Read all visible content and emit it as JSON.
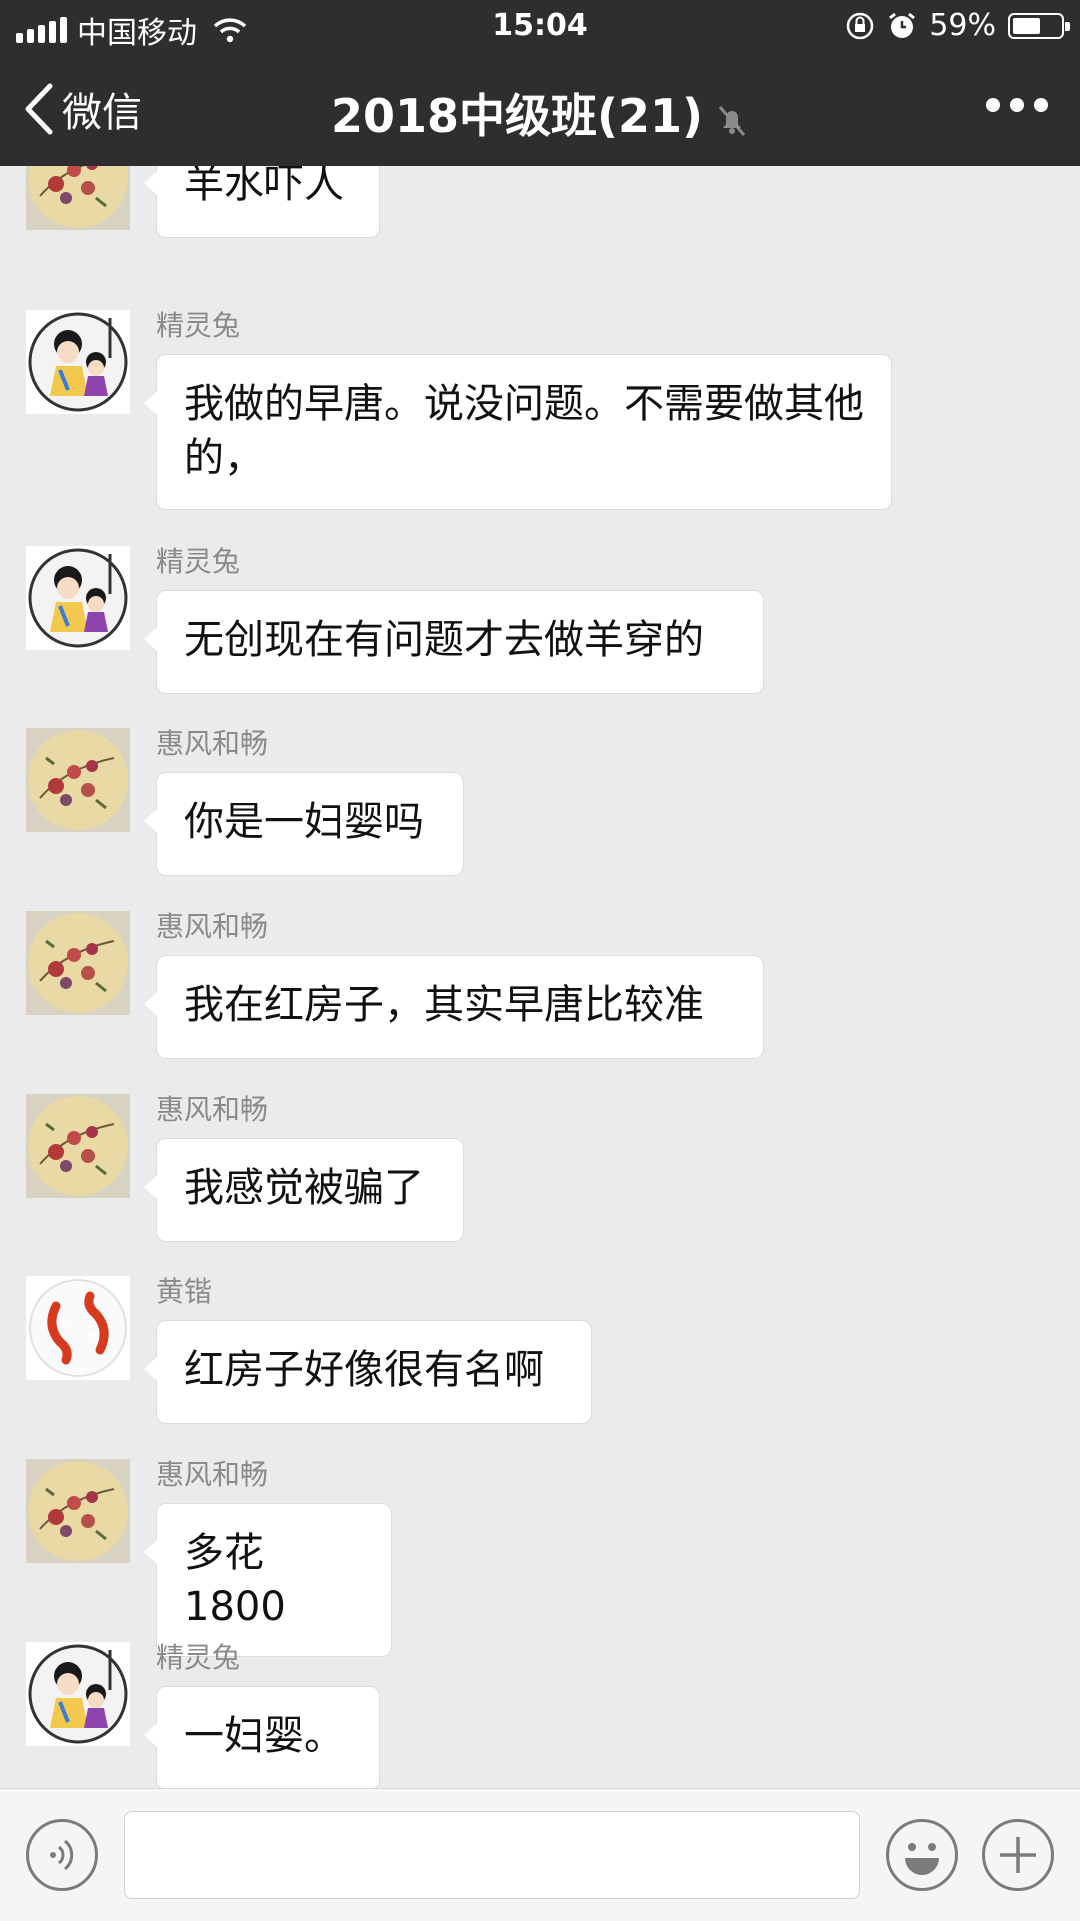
{
  "status_bar": {
    "carrier": "中国移动",
    "time": "15:04",
    "battery": "59%",
    "battery_level": 0.59
  },
  "nav": {
    "back_label": "微信",
    "title": "2018中级班(21)"
  },
  "messages": [
    {
      "sender": "",
      "text": "羊水吓人",
      "avatar": "flower"
    },
    {
      "sender": "精灵兔",
      "text": "我做的早唐。说没问题。不需要做其他的，",
      "avatar": "cartoon"
    },
    {
      "sender": "精灵兔",
      "text": "无创现在有问题才去做羊穿的",
      "avatar": "cartoon"
    },
    {
      "sender": "惠风和畅",
      "text": "你是一妇婴吗",
      "avatar": "flower"
    },
    {
      "sender": "惠风和畅",
      "text": "我在红房子，其实早唐比较准",
      "avatar": "flower"
    },
    {
      "sender": "惠风和畅",
      "text": "我感觉被骗了",
      "avatar": "flower"
    },
    {
      "sender": "黄锴",
      "text": "红房子好像很有名啊",
      "avatar": "koi"
    },
    {
      "sender": "惠风和畅",
      "text": "多花1800",
      "avatar": "flower"
    },
    {
      "sender": "精灵兔",
      "text": "一妇婴。",
      "avatar": "cartoon"
    }
  ],
  "input": {
    "value": ""
  }
}
